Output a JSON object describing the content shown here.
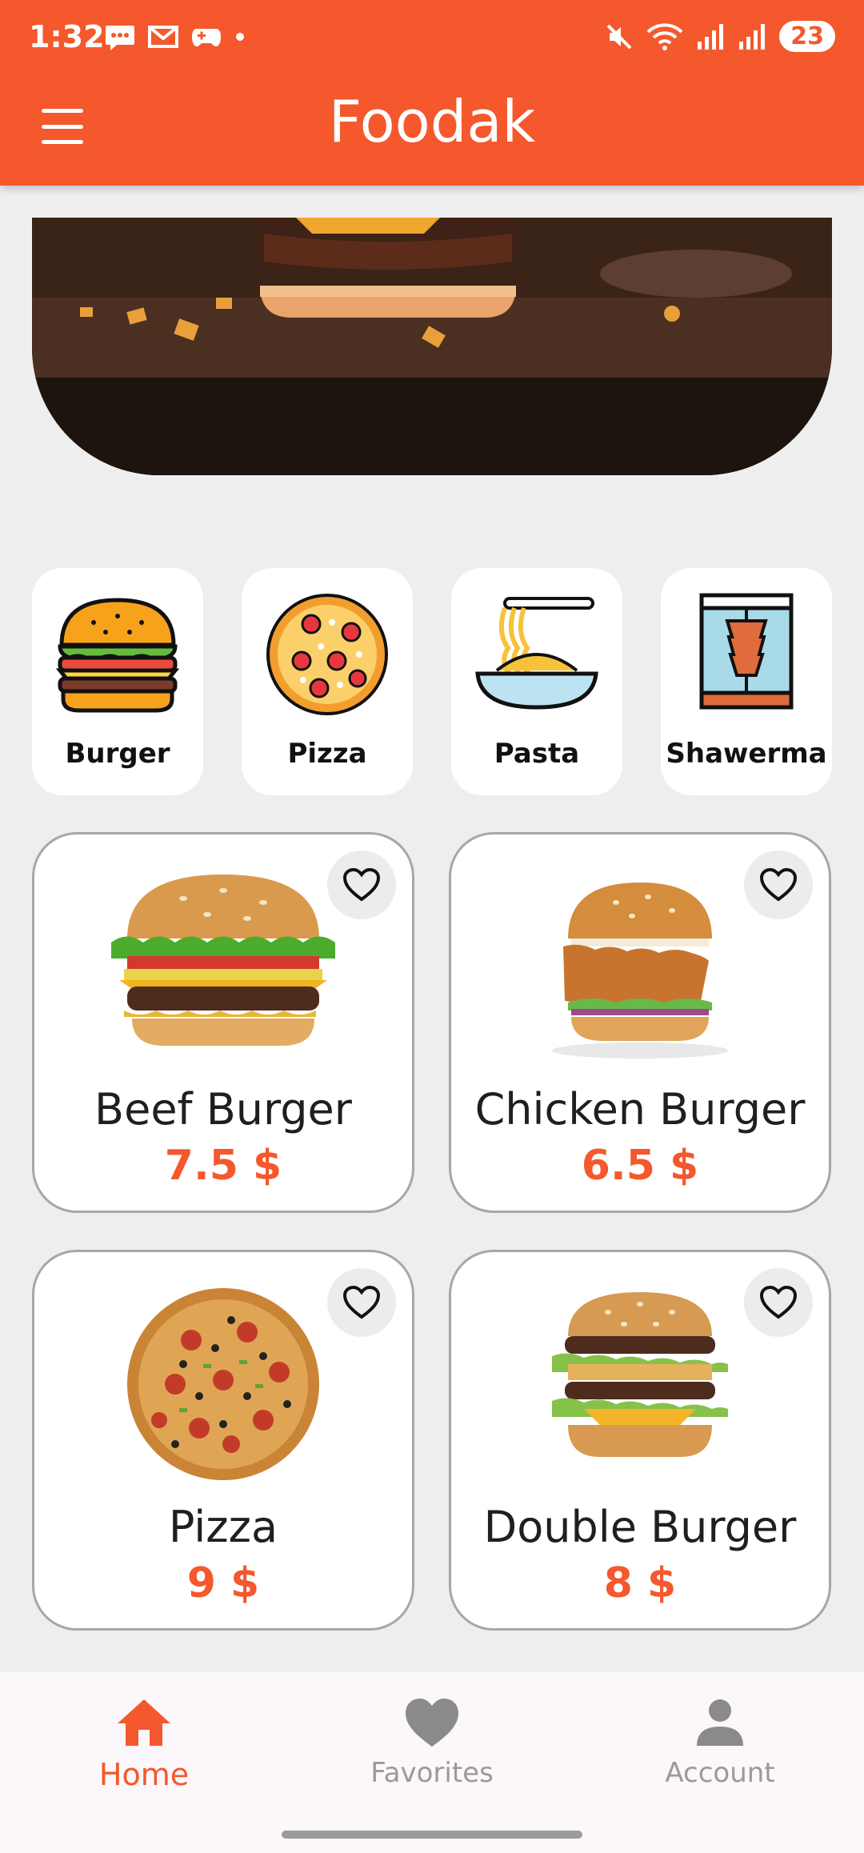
{
  "status_bar": {
    "time": "1:32",
    "battery": "23"
  },
  "app_bar": {
    "title": "Foodak"
  },
  "categories": [
    {
      "label": "Burger"
    },
    {
      "label": "Pizza"
    },
    {
      "label": "Pasta"
    },
    {
      "label": "Shawerma"
    }
  ],
  "products": [
    {
      "name": "Beef Burger",
      "price": "7.5 $"
    },
    {
      "name": "Chicken Burger",
      "price": "6.5 $"
    },
    {
      "name": "Pizza",
      "price": "9 $"
    },
    {
      "name": "Double Burger",
      "price": "8 $"
    }
  ],
  "bottom_nav": [
    {
      "label": "Home",
      "active": true
    },
    {
      "label": "Favorites",
      "active": false
    },
    {
      "label": "Account",
      "active": false
    }
  ],
  "colors": {
    "accent": "#f4582c",
    "background": "#efeeef"
  }
}
